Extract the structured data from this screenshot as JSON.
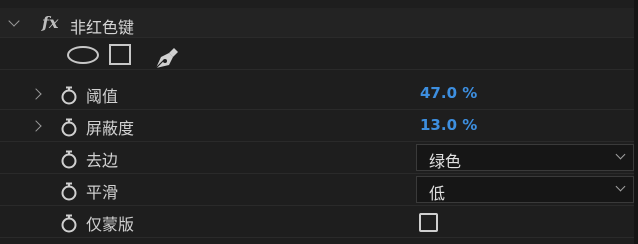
{
  "effect": {
    "name": "非红色键",
    "fx_label": "fx",
    "mask_tools": [
      "ellipse-mask-icon",
      "rectangle-mask-icon",
      "pen-mask-icon"
    ]
  },
  "properties": [
    {
      "label": "阈值",
      "value": "47.0 %"
    },
    {
      "label": "屏蔽度",
      "value": "13.0 %"
    },
    {
      "label": "去边",
      "value": "绿色"
    },
    {
      "label": "平滑",
      "value": "低"
    },
    {
      "label": "仅蒙版",
      "checked": false
    }
  ],
  "colors": {
    "background": "#1e1e1e",
    "value_blue": "#3d8fe0",
    "text": "#d0d0d0"
  }
}
